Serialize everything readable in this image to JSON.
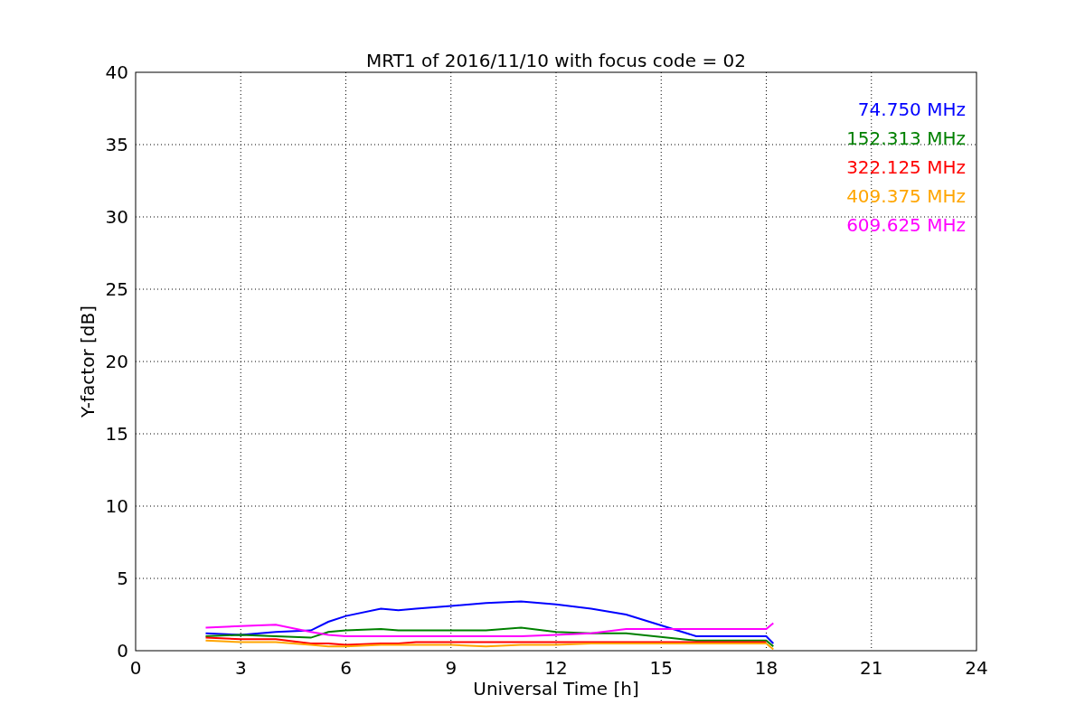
{
  "chart_data": {
    "type": "line",
    "title": "MRT1 of 2016/11/10 with focus code = 02",
    "xlabel": "Universal Time [h]",
    "ylabel": "Y-factor [dB]",
    "x": [
      2,
      3,
      4,
      5,
      5.5,
      6,
      7,
      7.5,
      8,
      9,
      10,
      11,
      12,
      13,
      14,
      16,
      18,
      18.2
    ],
    "series": [
      {
        "name": "74.750 MHz",
        "color": "#0000ff",
        "values": [
          1.2,
          1.1,
          1.3,
          1.4,
          2.0,
          2.4,
          2.9,
          2.8,
          2.9,
          3.1,
          3.3,
          3.4,
          3.2,
          2.9,
          2.5,
          1.0,
          1.0,
          0.5
        ]
      },
      {
        "name": "152.313 MHz",
        "color": "#008000",
        "values": [
          1.0,
          1.1,
          1.0,
          0.9,
          1.3,
          1.4,
          1.5,
          1.4,
          1.4,
          1.4,
          1.4,
          1.6,
          1.3,
          1.2,
          1.2,
          0.7,
          0.7,
          0.3
        ]
      },
      {
        "name": "322.125 MHz",
        "color": "#ff0000",
        "values": [
          0.9,
          0.8,
          0.8,
          0.5,
          0.5,
          0.4,
          0.5,
          0.5,
          0.6,
          0.6,
          0.6,
          0.6,
          0.6,
          0.6,
          0.6,
          0.6,
          0.6,
          null
        ]
      },
      {
        "name": "409.375 MHz",
        "color": "#ffa500",
        "values": [
          0.7,
          0.6,
          0.6,
          0.4,
          0.3,
          0.3,
          0.4,
          0.4,
          0.4,
          0.4,
          0.3,
          0.4,
          0.4,
          0.5,
          0.5,
          0.5,
          0.5,
          0.1
        ]
      },
      {
        "name": "609.625 MHz",
        "color": "#ff00ff",
        "values": [
          1.6,
          1.7,
          1.8,
          1.3,
          1.1,
          1.0,
          1.0,
          1.0,
          1.0,
          1.0,
          1.0,
          1.0,
          1.1,
          1.2,
          1.5,
          1.5,
          1.5,
          1.9
        ]
      }
    ],
    "grid": true,
    "xlim": [
      0,
      24
    ],
    "ylim": [
      0,
      40
    ],
    "xticks": [
      0,
      3,
      6,
      9,
      12,
      15,
      18,
      21,
      24
    ],
    "yticks": [
      0,
      5,
      10,
      15,
      20,
      25,
      30,
      35,
      40
    ]
  }
}
